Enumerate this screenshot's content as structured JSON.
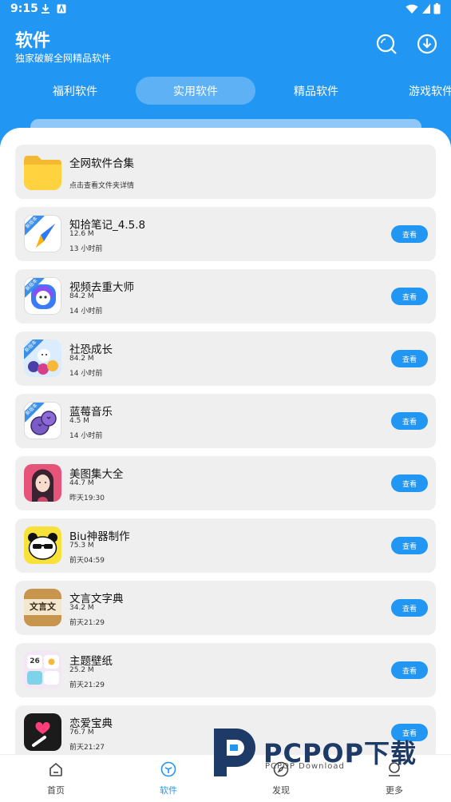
{
  "status": {
    "time": "9:15"
  },
  "header": {
    "title": "软件",
    "subtitle": "独家破解全网精品软件"
  },
  "tabs": [
    {
      "label": "福利软件"
    },
    {
      "label": "实用软件"
    },
    {
      "label": "精品软件"
    },
    {
      "label": "游戏软件"
    }
  ],
  "folder": {
    "name": "全网软件合集",
    "desc": "点击查看文件夹详情"
  },
  "apps": [
    {
      "name": "知拾笔记_4.5.8",
      "size": "12.6 M",
      "time": "13 小时前",
      "button": "查看",
      "badge": "新版本"
    },
    {
      "name": "视频去重大师",
      "size": "84.2 M",
      "time": "14 小时前",
      "button": "查看",
      "badge": "新版本"
    },
    {
      "name": "社恐成长",
      "size": "84.2 M",
      "time": "14 小时前",
      "button": "查看",
      "badge": "新版本"
    },
    {
      "name": "蓝莓音乐",
      "size": "4.5 M",
      "time": "14 小时前",
      "button": "查看",
      "badge": "新版本"
    },
    {
      "name": "美图集大全",
      "size": "44.7 M",
      "time": "昨天19:30",
      "button": "查看"
    },
    {
      "name": "Biu神器制作",
      "size": "75.3 M",
      "time": "前天04:59",
      "button": "查看"
    },
    {
      "name": "文言文字典",
      "size": "34.2 M",
      "time": "前天21:29",
      "button": "查看",
      "icon_text": "文言文"
    },
    {
      "name": "主题壁纸",
      "size": "25.2 M",
      "time": "前天21:29",
      "button": "查看",
      "icon_text": "26"
    },
    {
      "name": "恋爱宝典",
      "size": "76.7 M",
      "time": "前天21:27",
      "button": "查看"
    }
  ],
  "nav": [
    {
      "label": "首页"
    },
    {
      "label": "软件"
    },
    {
      "label": "发现"
    },
    {
      "label": "更多"
    }
  ],
  "watermark": {
    "text": "PCPOP下载",
    "sub": "PCPOP Download"
  },
  "colors": {
    "primary": "#2196f3",
    "card": "#efefef"
  }
}
